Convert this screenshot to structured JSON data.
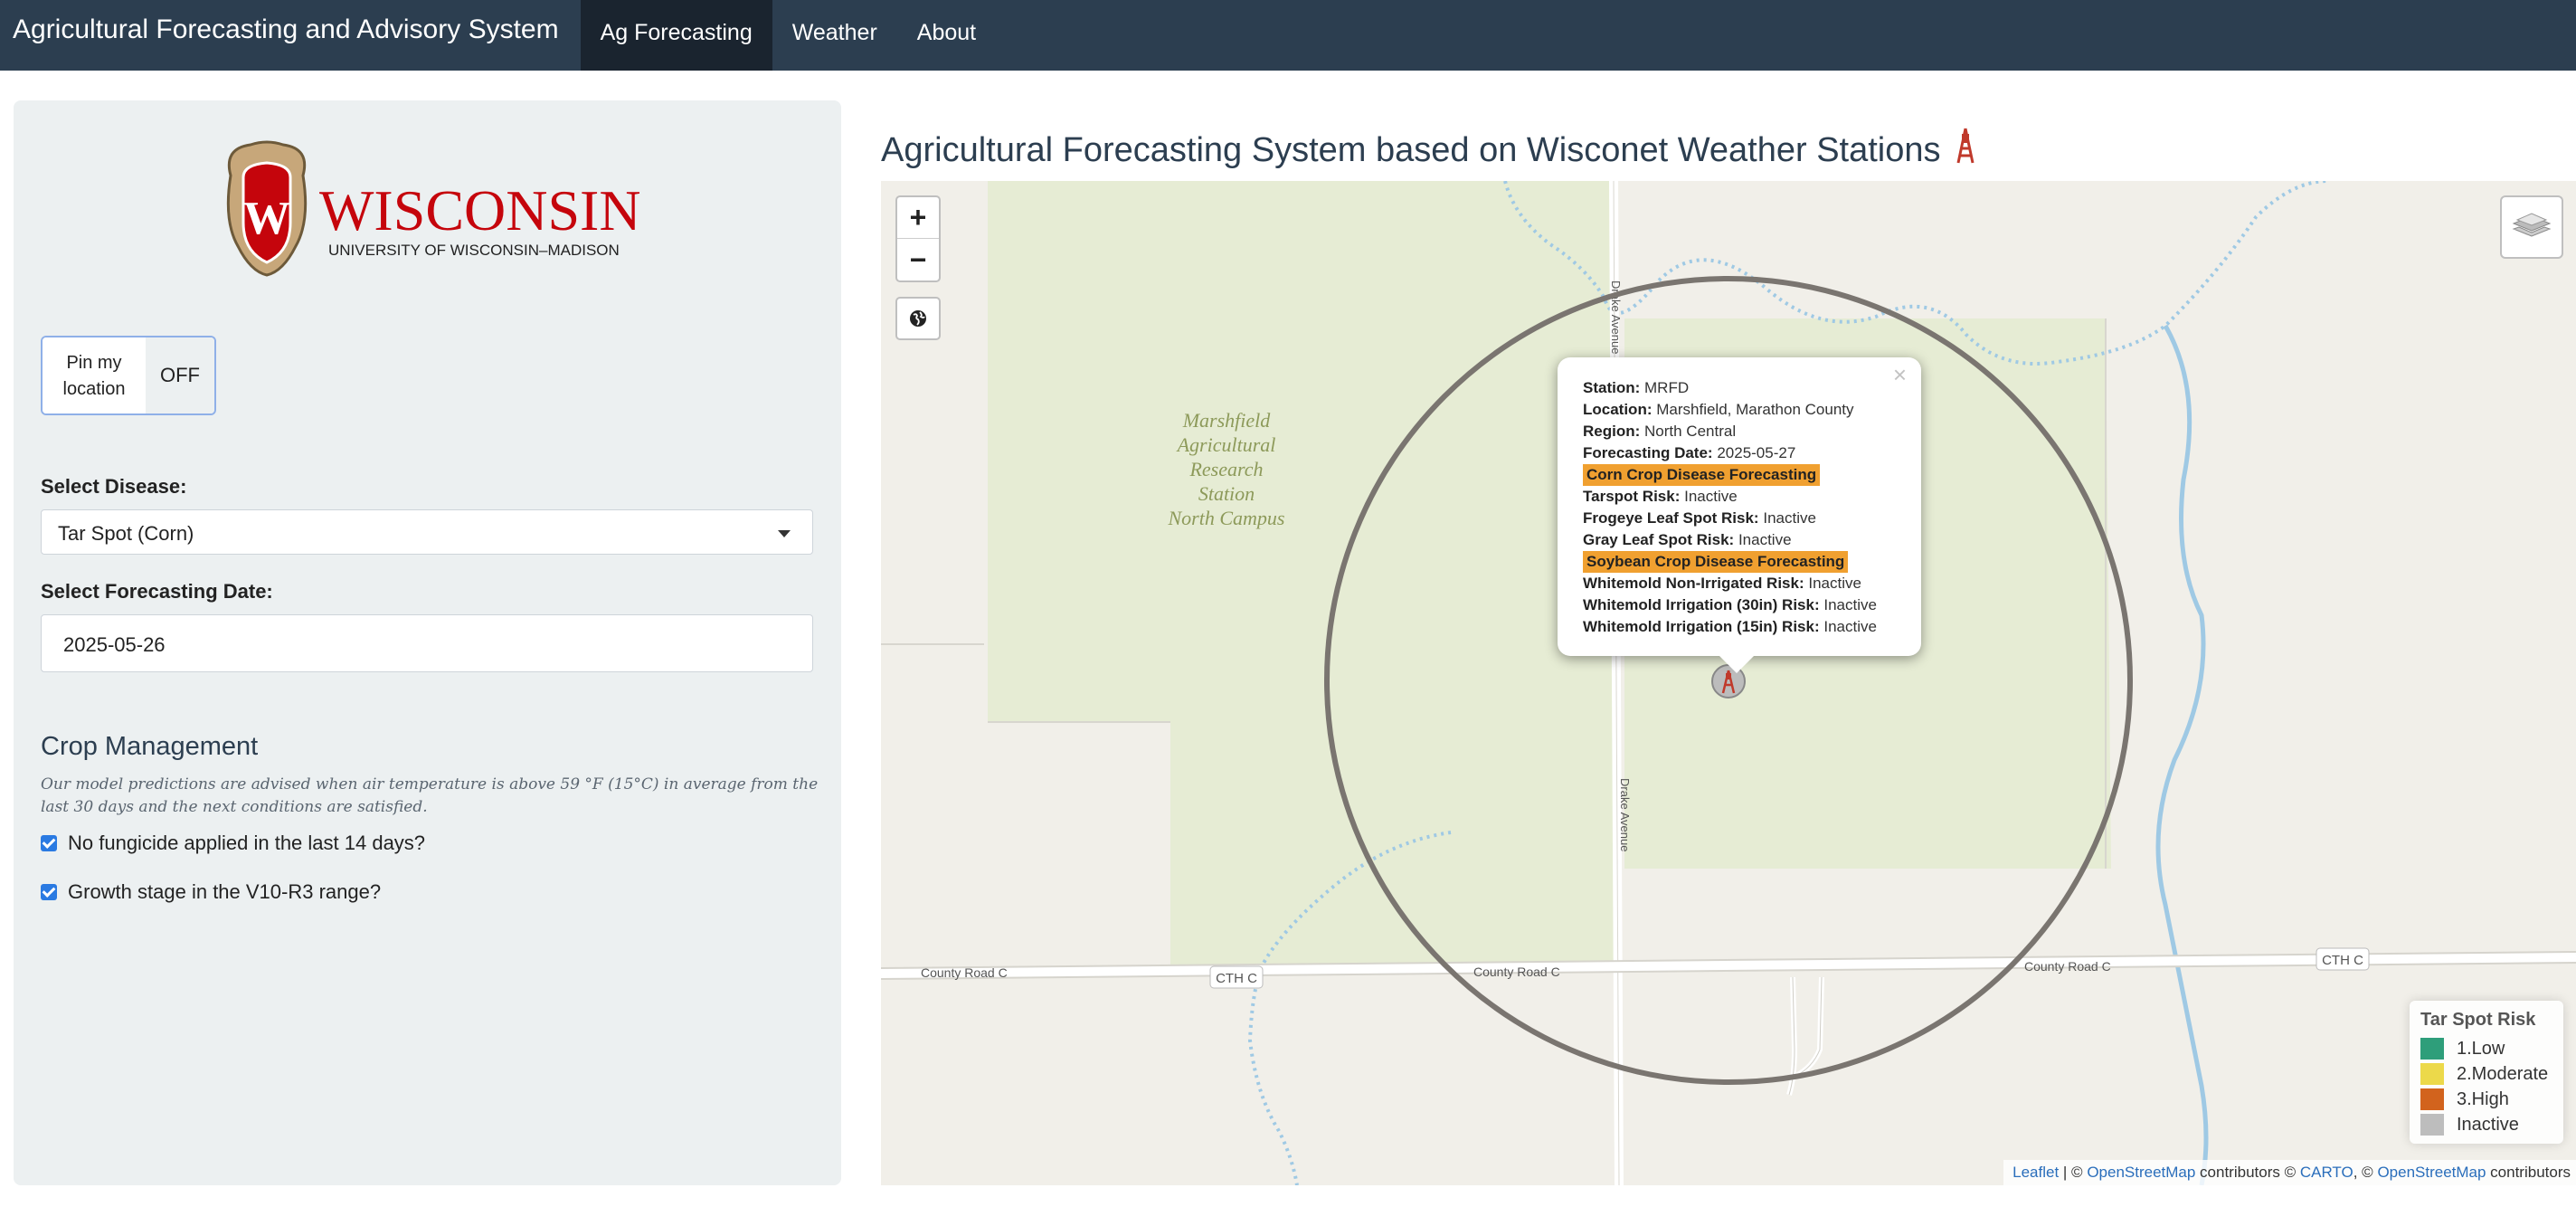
{
  "navbar": {
    "brand": "Agricultural Forecasting and Advisory System",
    "items": [
      {
        "label": "Ag Forecasting",
        "active": true
      },
      {
        "label": "Weather",
        "active": false
      },
      {
        "label": "About",
        "active": false
      }
    ]
  },
  "sidebar": {
    "logo": {
      "word": "WISCONSIN",
      "sub": "UNIVERSITY OF WISCONSIN–MADISON"
    },
    "pin": {
      "label": "Pin my location",
      "state": "OFF"
    },
    "disease": {
      "label": "Select Disease:",
      "value": "Tar Spot (Corn)"
    },
    "date": {
      "label": "Select Forecasting Date:",
      "value": "2025-05-26"
    },
    "crop": {
      "title": "Crop Management",
      "note": "Our model predictions are advised when air temperature is above 59 °F (15°C) in average from the last 30 days and the next conditions are satisfied.",
      "checks": [
        {
          "label": "No fungicide applied in the last 14 days?",
          "checked": true
        },
        {
          "label": "Growth stage in the V10-R3 range?",
          "checked": true
        }
      ]
    }
  },
  "main": {
    "title": "Agricultural Forecasting System based on Wisconet Weather Stations"
  },
  "map": {
    "zoom_in": "+",
    "zoom_out": "−",
    "place_label": [
      "Marshfield",
      "Agricultural",
      "Research",
      "Station",
      "North Campus"
    ],
    "roads": {
      "county_c": "County Road C",
      "cth_c": "CTH C",
      "drake": "Drake Avenue"
    },
    "popup": {
      "close": "×",
      "station_k": "Station:",
      "station_v": "MRFD",
      "location_k": "Location:",
      "location_v": "Marshfield, Marathon County",
      "region_k": "Region:",
      "region_v": "North Central",
      "date_k": "Forecasting Date:",
      "date_v": "2025-05-27",
      "corn_header": "Corn Crop Disease Forecasting",
      "tarspot_k": "Tarspot Risk:",
      "tarspot_v": "Inactive",
      "frogeye_k": "Frogeye Leaf Spot Risk:",
      "frogeye_v": "Inactive",
      "gray_k": "Gray Leaf Spot Risk:",
      "gray_v": "Inactive",
      "soy_header": "Soybean Crop Disease Forecasting",
      "wm_nonirr_k": "Whitemold Non-Irrigated Risk:",
      "wm_nonirr_v": "Inactive",
      "wm_30_k": "Whitemold Irrigation (30in) Risk:",
      "wm_30_v": "Inactive",
      "wm_15_k": "Whitemold Irrigation (15in) Risk:",
      "wm_15_v": "Inactive"
    },
    "legend": {
      "title": "Tar Spot Risk",
      "items": [
        {
          "label": "1.Low",
          "color": "#2e9e7a"
        },
        {
          "label": "2.Moderate",
          "color": "#ecd94a"
        },
        {
          "label": "3.High",
          "color": "#d2631d"
        },
        {
          "label": "Inactive",
          "color": "#bdbdbd"
        }
      ]
    },
    "attribution": {
      "leaflet": "Leaflet",
      "sep1": " | © ",
      "osm1": "OpenStreetMap",
      "mid": " contributors © ",
      "carto": "CARTO",
      "sep2": ", © ",
      "osm2": "OpenStreetMap",
      "end": " contributors"
    }
  }
}
